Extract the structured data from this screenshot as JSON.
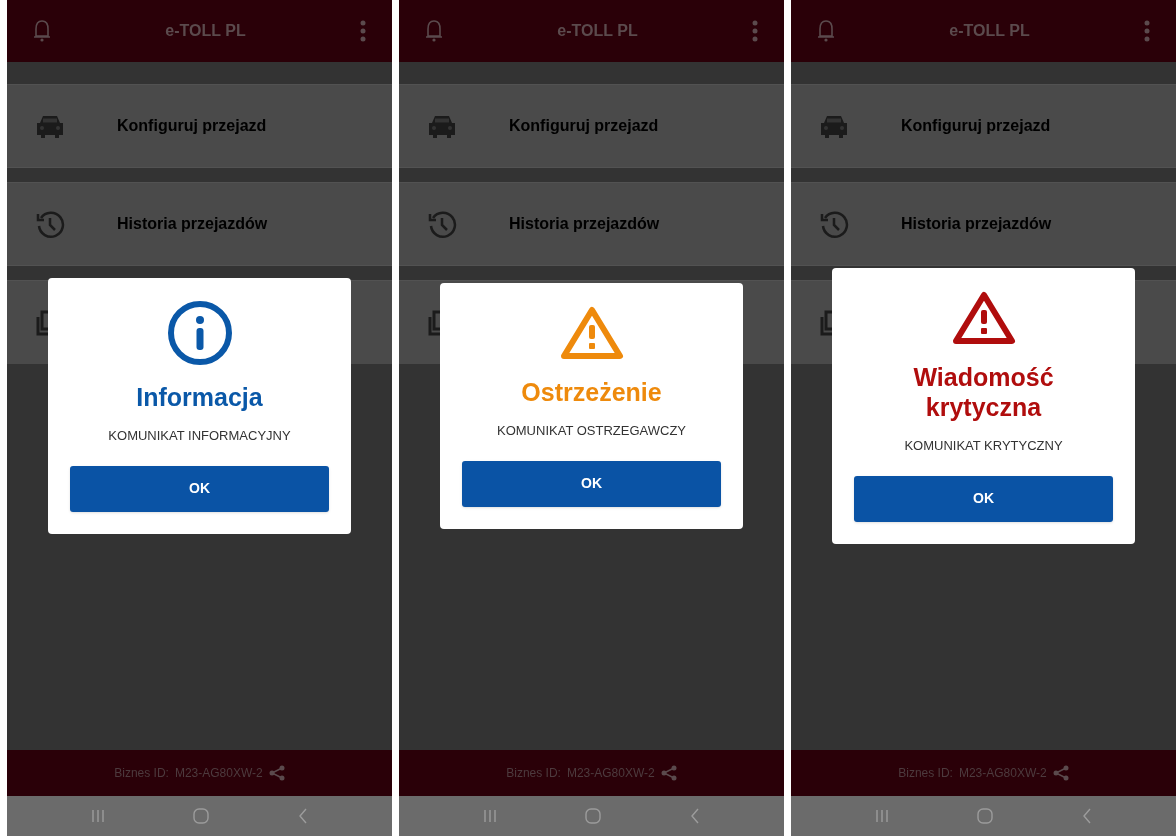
{
  "screens": [
    {
      "app_bar": {
        "title": "e-TOLL PL"
      },
      "menu": [
        {
          "label": "Konfiguruj przejazd"
        },
        {
          "label": "Historia przejazdów"
        }
      ],
      "dialog": {
        "kind": "info",
        "title": "Informacja",
        "message": "KOMUNIKAT INFORMACYJNY",
        "button": "OK"
      },
      "footer": {
        "label": "Biznes ID:",
        "value": "M23-AG80XW-2"
      }
    },
    {
      "app_bar": {
        "title": "e-TOLL PL"
      },
      "menu": [
        {
          "label": "Konfiguruj przejazd"
        },
        {
          "label": "Historia przejazdów"
        }
      ],
      "dialog": {
        "kind": "warning",
        "title": "Ostrzeżenie",
        "message": "KOMUNIKAT OSTRZEGAWCZY",
        "button": "OK"
      },
      "footer": {
        "label": "Biznes ID:",
        "value": "M23-AG80XW-2"
      }
    },
    {
      "app_bar": {
        "title": "e-TOLL PL"
      },
      "menu": [
        {
          "label": "Konfiguruj przejazd"
        },
        {
          "label": "Historia przejazdów"
        }
      ],
      "dialog": {
        "kind": "critical",
        "title": "Wiadomość krytyczna",
        "message": "KOMUNIKAT KRYTYCZNY",
        "button": "OK"
      },
      "footer": {
        "label": "Biznes ID:",
        "value": "M23-AG80XW-2"
      }
    }
  ]
}
